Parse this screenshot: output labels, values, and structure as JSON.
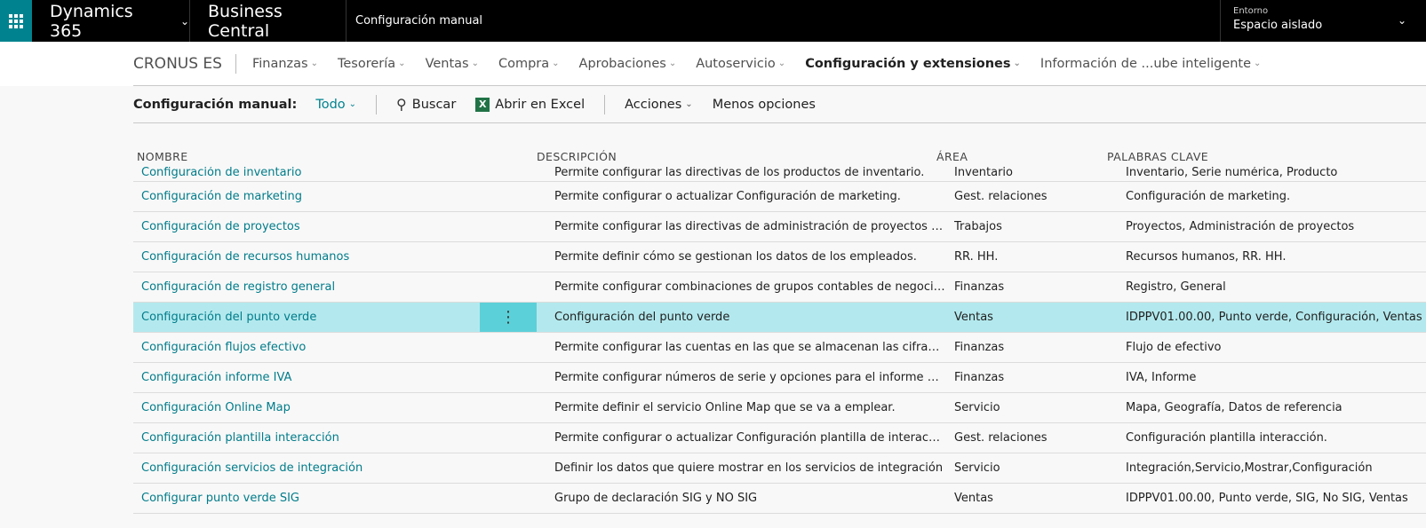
{
  "topbar": {
    "brand": "Dynamics 365",
    "product": "Business Central",
    "page_title": "Configuración manual",
    "environment_label": "Entorno",
    "environment_value": "Espacio aislado"
  },
  "nav": {
    "company": "CRONUS ES",
    "items": [
      {
        "label": "Finanzas"
      },
      {
        "label": "Tesorería"
      },
      {
        "label": "Ventas"
      },
      {
        "label": "Compra"
      },
      {
        "label": "Aprobaciones"
      },
      {
        "label": "Autoservicio"
      },
      {
        "label": "Configuración y extensiones",
        "active": true
      },
      {
        "label": "Información de ...ube inteligente"
      }
    ]
  },
  "actionbar": {
    "caption": "Configuración manual:",
    "filter": "Todo",
    "search": "Buscar",
    "excel": "Abrir en Excel",
    "actions": "Acciones",
    "fewer": "Menos opciones"
  },
  "columns": {
    "name": "NOMBRE",
    "description": "DESCRIPCIÓN",
    "area": "ÁREA",
    "keywords": "PALABRAS CLAVE"
  },
  "rows": [
    {
      "name": "Configuración de inventario",
      "description": "Permite configurar las directivas de los productos de inventario.",
      "area": "Inventario",
      "keywords": "Inventario, Serie numérica, Producto"
    },
    {
      "name": "Configuración de marketing",
      "description": "Permite configurar o actualizar Configuración de marketing.",
      "area": "Gest. relaciones",
      "keywords": "Configuración de marketing."
    },
    {
      "name": "Configuración de proyectos",
      "description": "Permite configurar las directivas de administración de proyectos (proye...",
      "area": "Trabajos",
      "keywords": "Proyectos, Administración de proyectos"
    },
    {
      "name": "Configuración de recursos humanos",
      "description": "Permite definir cómo se gestionan los datos de los empleados.",
      "area": "RR. HH.",
      "keywords": "Recursos humanos, RR. HH."
    },
    {
      "name": "Configuración de registro general",
      "description": "Permite configurar combinaciones de grupos contables de negocio gen...",
      "area": "Finanzas",
      "keywords": "Registro, General"
    },
    {
      "name": "Configuración del punto verde",
      "description": "Configuración del punto verde",
      "area": "Ventas",
      "keywords": "IDPPV01.00.00, Punto verde, Configuración, Ventas"
    },
    {
      "name": "Configuración flujos efectivo",
      "description": "Permite configurar las cuentas en las que se almacenan las cifras de fluj...",
      "area": "Finanzas",
      "keywords": "Flujo de efectivo"
    },
    {
      "name": "Configuración informe IVA",
      "description": "Permite configurar números de serie y opciones para el informe que se ...",
      "area": "Finanzas",
      "keywords": "IVA, Informe"
    },
    {
      "name": "Configuración Online Map",
      "description": "Permite definir el servicio Online Map que se va a emplear.",
      "area": "Servicio",
      "keywords": "Mapa, Geografía, Datos de referencia"
    },
    {
      "name": "Configuración plantilla interacción",
      "description": "Permite configurar o actualizar Configuración plantilla de interacción.",
      "area": "Gest. relaciones",
      "keywords": "Configuración plantilla interacción."
    },
    {
      "name": "Configuración servicios de integración",
      "description": "Definir los datos que quiere mostrar en los servicios de integración",
      "area": "Servicio",
      "keywords": "Integración,Servicio,Mostrar,Configuración"
    },
    {
      "name": "Configurar punto verde SIG",
      "description": "Grupo de declaración SIG y NO SIG",
      "area": "Ventas",
      "keywords": "IDPPV01.00.00, Punto verde, SIG, No SIG, Ventas"
    }
  ],
  "selected_row": 5,
  "colors": {
    "accent": "#00838f",
    "selected": "#b3e9ee"
  }
}
